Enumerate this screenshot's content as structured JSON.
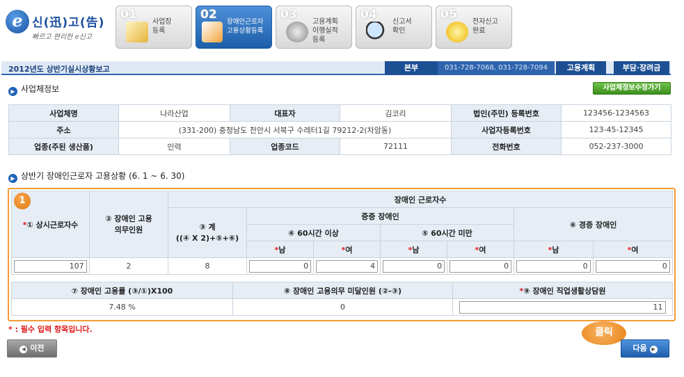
{
  "logo": {
    "letter": "e",
    "title": "신(迅)고(告)",
    "subtitle": "빠르고 편리한 e신고"
  },
  "steps": [
    {
      "num": "01",
      "label": "사업장\n등록"
    },
    {
      "num": "02",
      "label": "장애인근로자\n고용상황등록"
    },
    {
      "num": "03",
      "label": "고용계획\n이행실적\n등록"
    },
    {
      "num": "04",
      "label": "신고서\n확인"
    },
    {
      "num": "05",
      "label": "전자신고\n완료"
    }
  ],
  "titlebar": {
    "title": "2012년도 상반기실시상황보고",
    "branch": "본부",
    "phone": "031-728-7068, 031-728-7094",
    "plan": "고용계획",
    "levy": "부담·장려금"
  },
  "business_section": {
    "title": "사업체정보",
    "edit_button": "사업체정보수정가기",
    "rows": [
      [
        "사업체명",
        "나라산업",
        "대표자",
        "김코리",
        "법인(주민) 등록번호",
        "123456-1234563"
      ],
      [
        "주소",
        "(331-200) 충청남도 천안시 서북구 수레터1길 79212-2(차암동)",
        "사업자등록번호",
        "123-45-12345"
      ],
      [
        "업종(주된 생산품)",
        "인력",
        "업종코드",
        "72111",
        "전화번호",
        "052-237-3000"
      ]
    ]
  },
  "employment_section": {
    "title": "상반기 장애인근로자 고용상황 (6. 1 ~ 6. 30)",
    "badge": "1",
    "headers": {
      "regular": "① 상시근로자수",
      "quota": "② 장애인 고용\n의무인원",
      "total": "③ 계\n((④ X 2)+⑤+⑥)",
      "disabled_workers": "장애인 근로자수",
      "severe": "중증 장애인",
      "over60": "④ 60시간 이상",
      "under60": "⑤ 60시간 미만",
      "mild": "⑥ 경증 장애인",
      "male": "남",
      "female": "여"
    },
    "required_mark": "*",
    "values": {
      "regular": "107",
      "quota": "2",
      "total": "8",
      "over60_m": "0",
      "over60_f": "4",
      "under60_m": "0",
      "under60_f": "0",
      "mild_m": "0",
      "mild_f": "0"
    },
    "rate_headers": {
      "rate": "⑦ 장애인 고용률 (③/①)X100",
      "shortfall": "⑧ 장애인 고용의무 미달인원 (②-③)",
      "counselor": "⑨ 장애인 직업생활상담원"
    },
    "rate_values": {
      "rate": "7.48 %",
      "shortfall": "0",
      "counselor": "11"
    }
  },
  "footer": {
    "note": "* : 필수 입력 항목입니다.",
    "prev": "이전",
    "next": "다음",
    "click_hint": "클릭"
  }
}
